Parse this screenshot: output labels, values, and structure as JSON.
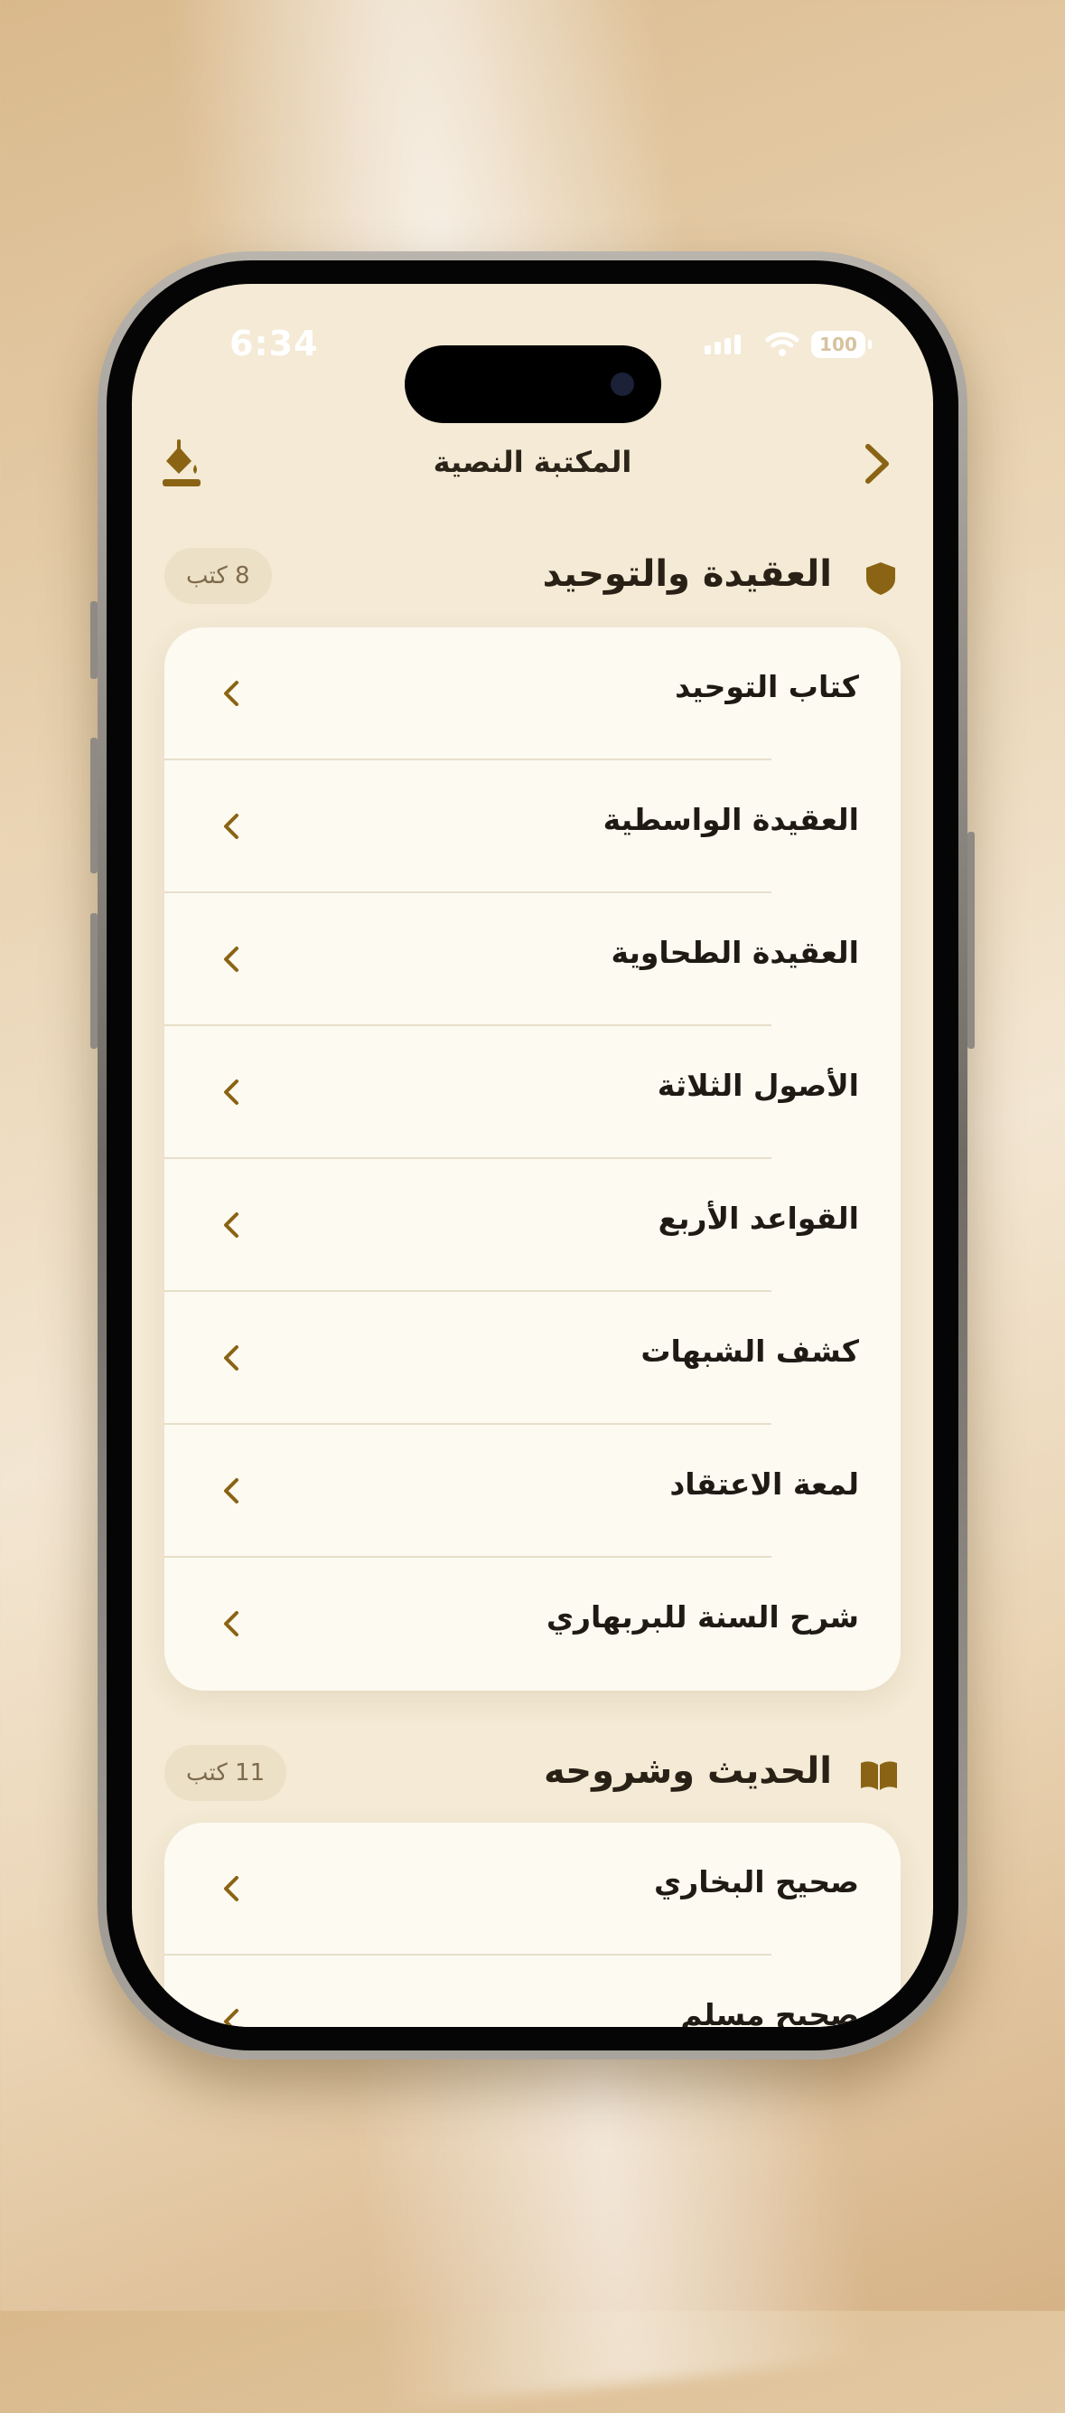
{
  "status_bar": {
    "time": "6:34",
    "battery": "100"
  },
  "navbar": {
    "title": "المكتبة النصية"
  },
  "sections": [
    {
      "title": "العقيدة والتوحيد",
      "count": "8 كتب",
      "icon": "shield-icon",
      "items": [
        {
          "label": "كتاب التوحيد"
        },
        {
          "label": "العقيدة الواسطية"
        },
        {
          "label": "العقيدة الطحاوية"
        },
        {
          "label": "الأصول الثلاثة"
        },
        {
          "label": "القواعد الأربع"
        },
        {
          "label": "كشف الشبهات"
        },
        {
          "label": "لمعة الاعتقاد"
        },
        {
          "label": "شرح السنة للبربهاري"
        }
      ]
    },
    {
      "title": "الحديث وشروحه",
      "count": "11 كتب",
      "icon": "open-book-icon",
      "items": [
        {
          "label": "صحيح البخاري"
        },
        {
          "label": "صحيح مسلم"
        }
      ]
    }
  ],
  "colors": {
    "accent": "#8a6414",
    "background": "#f4ead5",
    "card": "#fdfaf2"
  }
}
